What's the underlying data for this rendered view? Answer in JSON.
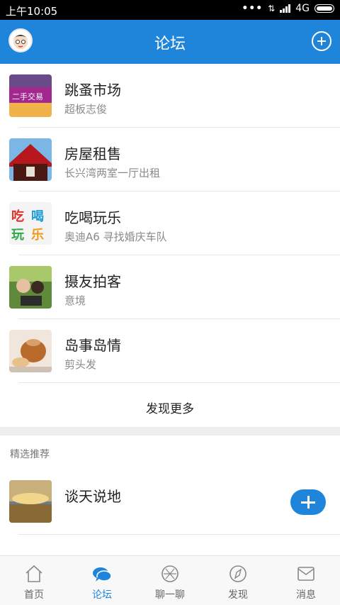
{
  "status_bar": {
    "time": "上午10:05",
    "network": "4G"
  },
  "header": {
    "title": "论坛"
  },
  "forums": [
    {
      "title": "跳蚤市场",
      "subtitle": "超板志俊",
      "thumb_text": "二手交易"
    },
    {
      "title": "房屋租售",
      "subtitle": "长兴湾两室一厅出租"
    },
    {
      "title": "吃喝玩乐",
      "subtitle": "奥迪A6 寻找婚庆车队",
      "thumb_text": "吃喝玩乐"
    },
    {
      "title": "摄友拍客",
      "subtitle": "意境"
    },
    {
      "title": "岛事岛情",
      "subtitle": "剪头发"
    }
  ],
  "more_label": "发现更多",
  "recommend": {
    "section_label": "精选推荐",
    "item_title": "谈天说地"
  },
  "nav": [
    {
      "label": "首页",
      "icon": "home-icon"
    },
    {
      "label": "论坛",
      "icon": "chat-bubble-icon",
      "active": true
    },
    {
      "label": "聊一聊",
      "icon": "aperture-icon"
    },
    {
      "label": "发现",
      "icon": "compass-icon"
    },
    {
      "label": "消息",
      "icon": "message-icon"
    }
  ],
  "colors": {
    "accent": "#1f85da",
    "status_bar": "#000000"
  }
}
